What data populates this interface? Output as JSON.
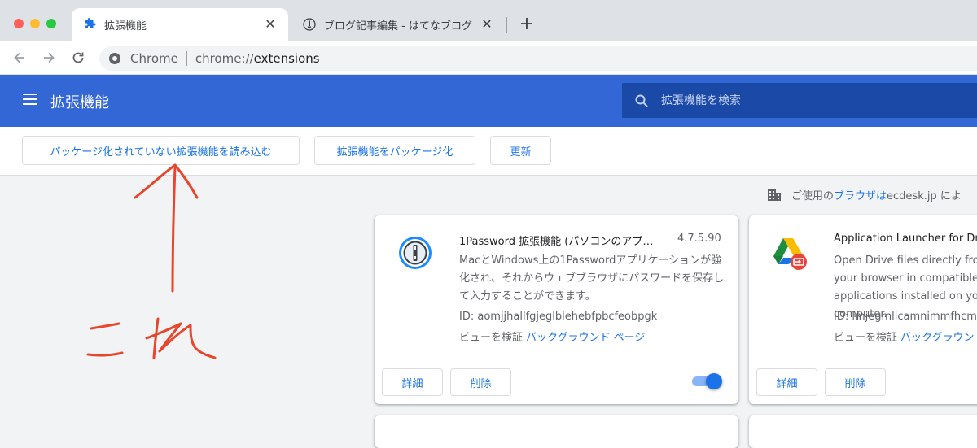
{
  "browser": {
    "tabs": [
      {
        "title": "拡張機能",
        "icon": "puzzle-icon",
        "active": true
      },
      {
        "title": "ブログ記事編集 - はてなブログ",
        "icon": "hatena-icon",
        "active": false
      }
    ],
    "new_tab_label": "+",
    "close_label": "✕",
    "omnibox": {
      "chip": "Chrome",
      "scheme": "chrome://",
      "host": "extensions"
    }
  },
  "page": {
    "title": "拡張機能",
    "search_placeholder": "拡張機能を検索",
    "accent": "#3367d6"
  },
  "devbar": {
    "load_unpacked": "パッケージ化されていない拡張機能を読み込む",
    "pack": "拡張機能をパッケージ化",
    "update": "更新"
  },
  "managed": {
    "prefix": "ご使用の",
    "link": "ブラウザは",
    "suffix": " ecdesk.jp によ"
  },
  "extensions": [
    {
      "name": "1Password 拡張機能 (パソコンのアプ…",
      "version": "4.7.5.90",
      "description": "MacとWindows上の1Passwordアプリケーションが強化され、それからウェブブラウザにパスワードを保存して入力することができます。",
      "id": "ID: aomjjhallfgjeglblehebfpbcfeobpgk",
      "inspect_label": "ビューを検証",
      "inspect_link": "バックグラウンド ページ",
      "details": "詳細",
      "remove": "削除",
      "enabled": true,
      "icon": "onepassword-icon"
    },
    {
      "name": "Application Launcher for Drive (by Google)",
      "description": "Open Drive files directly from your browser in compatible applications installed on your computer.",
      "id": "ID: lmjegmlicamnimmfhcmpkclmigmmcbeh",
      "inspect_label": "ビューを検証",
      "inspect_link": "バックグラウンド ページ",
      "details": "詳細",
      "remove": "削除",
      "icon": "google-drive-icon"
    }
  ],
  "annotation": {
    "text": "これ",
    "color": "#e8452c"
  }
}
